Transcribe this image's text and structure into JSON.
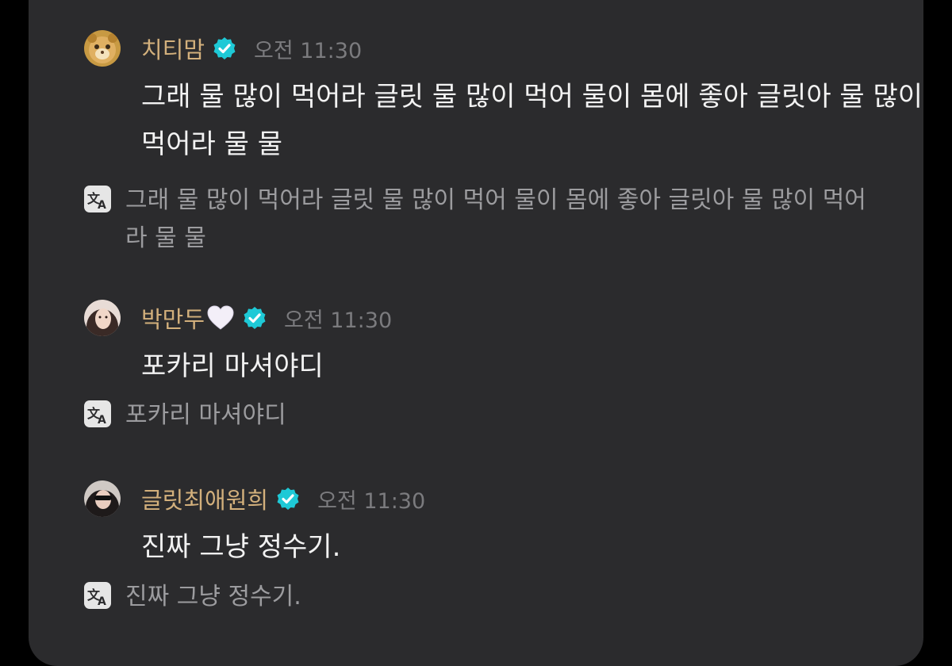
{
  "colors": {
    "background": "#000000",
    "panel": "#2b2b2d",
    "username": "#d3b07c",
    "timestamp": "#7b7b7e",
    "message": "#f2f2f2",
    "translation": "#9c9c9f",
    "verified_badge": "#1ec9d6"
  },
  "icons": {
    "verified": "verified-badge-icon",
    "translate": "translate-icon",
    "heart": "white-heart-emoji"
  },
  "messages": [
    {
      "username": "치티맘",
      "time": "오전 11:30",
      "text": "그래 물 많이 먹어라 글릿 물 많이 먹어 물이 몸에 좋아 글릿아 물 많이 먹어라 물 물",
      "translation": "그래 물 많이 먹어라 글릿 물 많이 먹어 물이 몸에 좋아 글릿아 물 많이 먹어라 물 물"
    },
    {
      "username": "박만두",
      "time": "오전 11:30",
      "text": "포카리 마셔야디",
      "translation": "포카리 마셔야디"
    },
    {
      "username": "글릿최애원희",
      "time": "오전 11:30",
      "text": "진짜 그냥 정수기.",
      "translation": "진짜 그냥 정수기."
    }
  ]
}
